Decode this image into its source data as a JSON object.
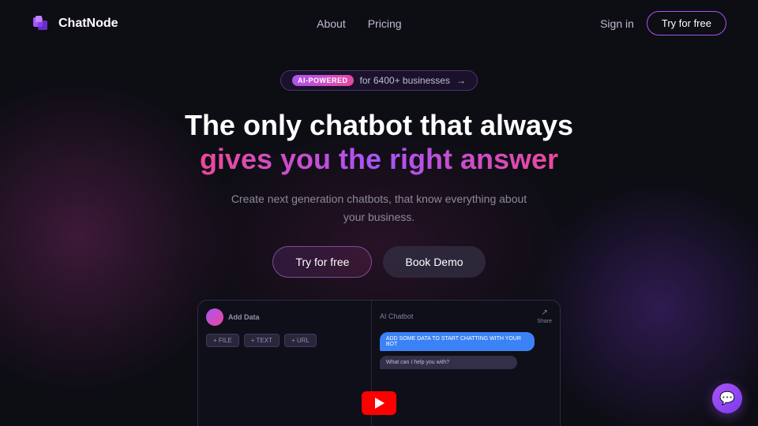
{
  "nav": {
    "logo_text": "ChatNode",
    "links": [
      {
        "label": "About",
        "id": "about"
      },
      {
        "label": "Pricing",
        "id": "pricing"
      }
    ],
    "sign_in": "Sign in",
    "try_free": "Try for free"
  },
  "badge": {
    "ai_label": "AI-POWERED",
    "text": "for 6400+ businesses",
    "arrow": "→"
  },
  "hero": {
    "title_line1": "The only chatbot that always",
    "title_line2": "gives you the right answer",
    "subtitle": "Create next generation chatbots, that know everything about your business.",
    "btn_try_free": "Try for free",
    "btn_book_demo": "Book Demo"
  },
  "preview": {
    "left_title": "Add Data",
    "btn_file": "+ FILE",
    "btn_text": "+ TEXT",
    "btn_url": "+ URL",
    "right_title": "AI Chatbot",
    "share_label": "Share",
    "chat_msg1": "ADD SOME DATA TO START CHATTING WITH YOUR BOT",
    "chat_msg2": "What can I help you with?"
  },
  "chat_widget": {
    "icon": "💬"
  },
  "colors": {
    "accent_purple": "#a855f7",
    "accent_pink": "#ec4899",
    "bg_dark": "#0d0d14",
    "nav_border": "#a855f7"
  }
}
